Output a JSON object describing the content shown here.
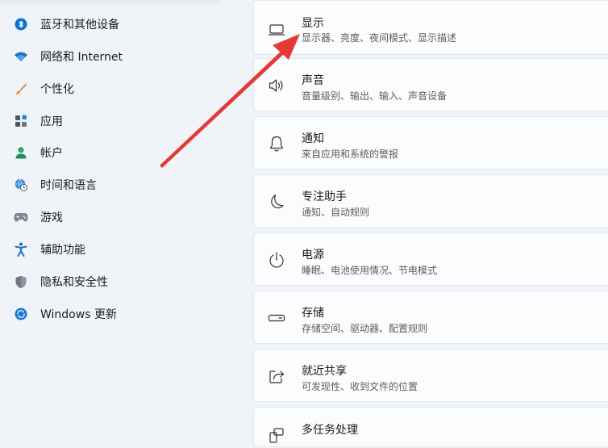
{
  "sidebar": {
    "items": [
      {
        "label": "蓝牙和其他设备",
        "icon": "bluetooth-icon"
      },
      {
        "label": "网络和 Internet",
        "icon": "wifi-icon"
      },
      {
        "label": "个性化",
        "icon": "brush-icon"
      },
      {
        "label": "应用",
        "icon": "apps-icon"
      },
      {
        "label": "帐户",
        "icon": "person-icon"
      },
      {
        "label": "时间和语言",
        "icon": "globe-clock-icon"
      },
      {
        "label": "游戏",
        "icon": "gamepad-icon"
      },
      {
        "label": "辅助功能",
        "icon": "accessibility-icon"
      },
      {
        "label": "隐私和安全性",
        "icon": "shield-icon"
      },
      {
        "label": "Windows 更新",
        "icon": "sync-icon"
      }
    ]
  },
  "main": {
    "cards": [
      {
        "title": "显示",
        "subtitle": "显示器、亮度、夜间模式、显示描述",
        "icon": "display-icon"
      },
      {
        "title": "声音",
        "subtitle": "音量级别、输出、输入、声音设备",
        "icon": "speaker-icon"
      },
      {
        "title": "通知",
        "subtitle": "来自应用和系统的警报",
        "icon": "bell-icon"
      },
      {
        "title": "专注助手",
        "subtitle": "通知、自动规则",
        "icon": "moon-icon"
      },
      {
        "title": "电源",
        "subtitle": "睡眠、电池使用情况、节电模式",
        "icon": "power-icon"
      },
      {
        "title": "存储",
        "subtitle": "存储空间、驱动器、配置规则",
        "icon": "drive-icon"
      },
      {
        "title": "就近共享",
        "subtitle": "可发现性、收到文件的位置",
        "icon": "share-icon"
      },
      {
        "title": "多任务处理",
        "subtitle": "",
        "icon": "multitask-icon"
      }
    ]
  },
  "colors": {
    "accent": "#0067c0",
    "annotation_arrow": "#e53935",
    "background": "#f0f4f9",
    "card": "#fbfcfe"
  }
}
